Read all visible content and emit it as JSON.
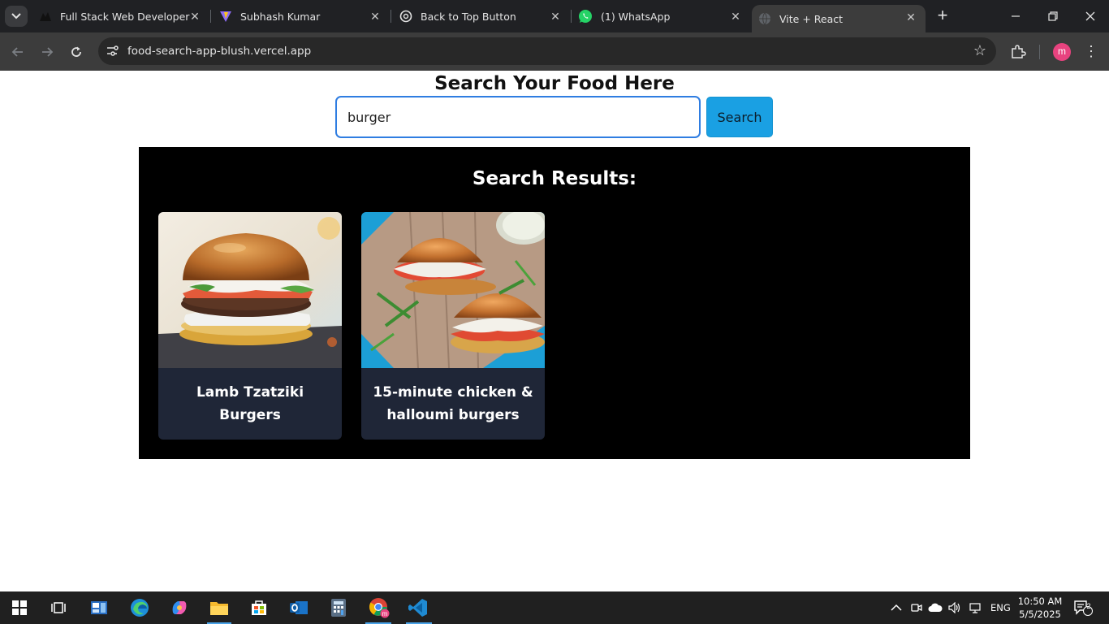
{
  "browser": {
    "tabs": [
      {
        "title": "Full Stack Web Developer",
        "icon": "dark-logo-icon",
        "active": false
      },
      {
        "title": "Subhash Kumar",
        "icon": "vite-logo-icon",
        "active": false
      },
      {
        "title": "Back to Top Button",
        "icon": "openai-logo-icon",
        "active": false
      },
      {
        "title": "(1) WhatsApp",
        "icon": "whatsapp-icon",
        "active": false
      },
      {
        "title": "Vite + React",
        "icon": "globe-icon",
        "active": true
      }
    ],
    "url": "food-search-app-blush.vercel.app",
    "profile_initial": "m"
  },
  "page": {
    "title": "Search Your Food Here",
    "search": {
      "value": "burger",
      "button_label": "Search"
    },
    "results_heading": "Search Results:",
    "results": [
      {
        "title": "Lamb Tzatziki Burgers",
        "image": "burger-photo"
      },
      {
        "title": "15-minute chicken & halloumi burgers",
        "image": "chicken-halloumi-burger-photo"
      }
    ]
  },
  "taskbar": {
    "apps": [
      "start-icon",
      "task-view-icon",
      "widgets-icon",
      "edge-icon",
      "copilot-icon",
      "file-explorer-icon",
      "microsoft-store-icon",
      "outlook-icon",
      "calculator-icon",
      "chrome-icon",
      "vscode-icon"
    ],
    "language": "ENG",
    "time": "10:50 AM",
    "date": "5/5/2025",
    "notifications": "2"
  }
}
